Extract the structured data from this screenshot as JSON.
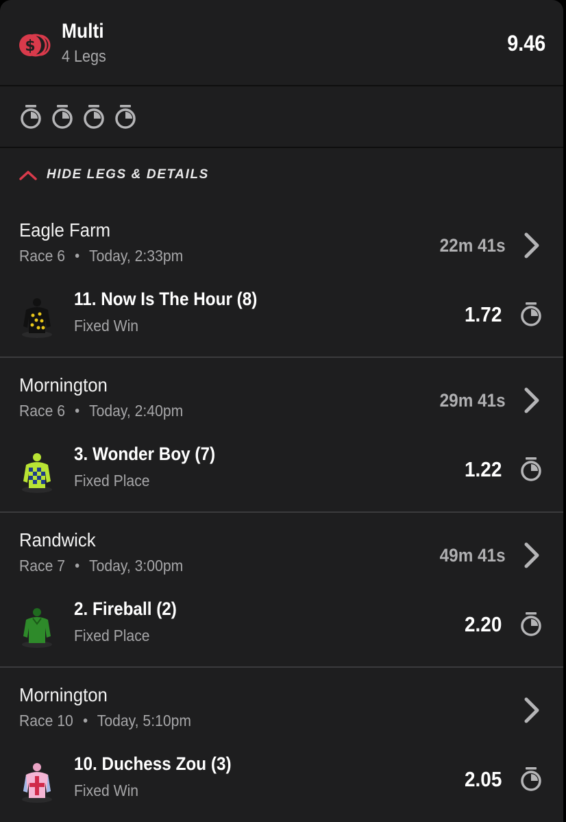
{
  "bet": {
    "title": "Multi",
    "subtitle": "4 Legs",
    "odds": "9.46",
    "icon": "dollar-coins-icon",
    "accent_color": "#d93a4b"
  },
  "status_timers": [
    "stopwatch-icon",
    "stopwatch-icon",
    "stopwatch-icon",
    "stopwatch-icon"
  ],
  "toggle": {
    "label": "HIDE LEGS & DETAILS",
    "icon": "chevron-up-icon"
  },
  "legs": [
    {
      "venue": "Eagle Farm",
      "race": "Race 6",
      "time": "Today, 2:33pm",
      "countdown": "22m 41s",
      "runner": "11. Now Is The Hour (8)",
      "bet_type": "Fixed Win",
      "odds": "1.72",
      "silk": "black-yellow-spots-silk"
    },
    {
      "venue": "Mornington",
      "race": "Race 6",
      "time": "Today, 2:40pm",
      "countdown": "29m 41s",
      "runner": "3. Wonder Boy (7)",
      "bet_type": "Fixed Place",
      "odds": "1.22",
      "silk": "lime-navy-check-silk"
    },
    {
      "venue": "Randwick",
      "race": "Race 7",
      "time": "Today, 3:00pm",
      "countdown": "49m 41s",
      "runner": "2. Fireball (2)",
      "bet_type": "Fixed Place",
      "odds": "2.20",
      "silk": "green-silk"
    },
    {
      "venue": "Mornington",
      "race": "Race 10",
      "time": "Today, 5:10pm",
      "countdown": "",
      "runner": "10. Duchess Zou (3)",
      "bet_type": "Fixed Win",
      "odds": "2.05",
      "silk": "pink-white-cross-silk"
    }
  ]
}
